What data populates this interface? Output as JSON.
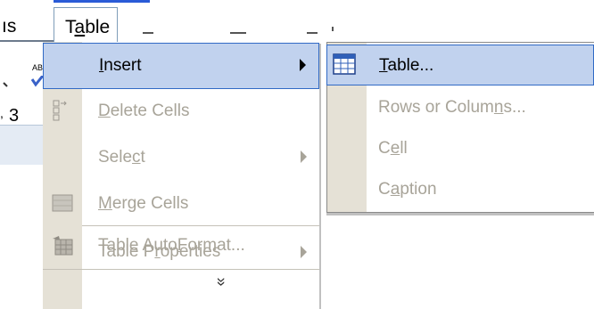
{
  "menubar": {
    "partial_left_item": "ıs",
    "active_menu": {
      "pre": "T",
      "mnemonic": "a",
      "post": "ble"
    }
  },
  "left_stub": {
    "text_1": "AB",
    "text_2": "3"
  },
  "menu": {
    "items": [
      {
        "pre": "",
        "mnemonic": "I",
        "post": "nsert",
        "enabled": true,
        "highlighted": true,
        "submenu": true,
        "icon": "none"
      },
      {
        "pre": "",
        "mnemonic": "D",
        "post": "elete Cells",
        "enabled": false,
        "submenu": false,
        "icon": "delete-cells-icon"
      },
      {
        "pre": "Sele",
        "mnemonic": "c",
        "post": "t",
        "enabled": false,
        "submenu": true,
        "icon": "none"
      },
      {
        "pre": "",
        "mnemonic": "M",
        "post": "erge Cells",
        "enabled": false,
        "submenu": false,
        "icon": "merge-cells-icon"
      },
      {
        "pre": "Table Auto",
        "mnemonic": "F",
        "post": "ormat...",
        "enabled": false,
        "submenu": false,
        "icon": "table-autoformat-icon"
      },
      {
        "pre": "Table P",
        "mnemonic": "r",
        "post": "operties",
        "enabled": false,
        "submenu": true,
        "icon": "none"
      }
    ],
    "expand_glyph": "»"
  },
  "submenu": {
    "items": [
      {
        "pre": "",
        "mnemonic": "T",
        "post": "able...",
        "enabled": true,
        "highlighted": true,
        "icon": "insert-table-icon"
      },
      {
        "pre": "Rows or Colum",
        "mnemonic": "n",
        "post": "s...",
        "enabled": false
      },
      {
        "pre": "C",
        "mnemonic": "e",
        "post": "ll",
        "enabled": false
      },
      {
        "pre": "C",
        "mnemonic": "a",
        "post": "ption",
        "enabled": false
      }
    ]
  },
  "colors": {
    "highlight_fill": "#c1d2ee",
    "highlight_border": "#316ac5",
    "disabled_text": "#a8a499",
    "gutter": "#e5e1d6"
  }
}
